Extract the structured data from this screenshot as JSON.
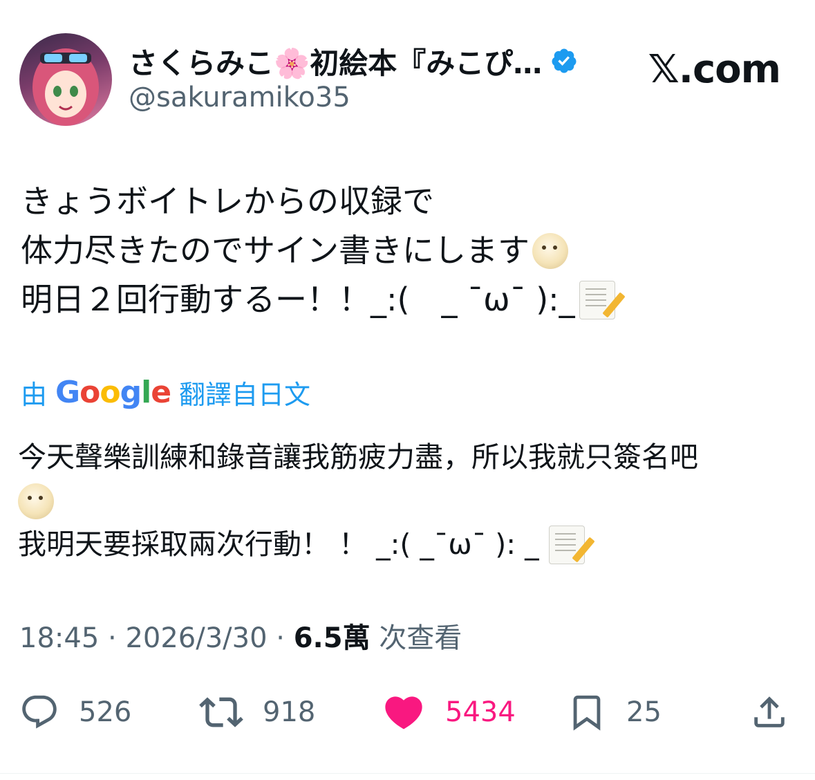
{
  "author": {
    "display_name": "さくらみこ🌸初絵本『みこぴ…",
    "handle": "@sakuramiko35",
    "verified": true
  },
  "site_logo": "𝕏.com",
  "tweet": {
    "lines": [
      "きょうボイトレからの収録で",
      "体力尽きたのでサイン書きにします",
      "明日２回行動するー！！_:(　_ ˉωˉ ):_"
    ],
    "emojis": [
      "face-in-clouds",
      "memo"
    ]
  },
  "translation": {
    "prefix": "由",
    "provider": "Google",
    "suffix": "翻譯自日文",
    "lines": [
      "今天聲樂訓練和錄音讓我筋疲力盡，所以我就只簽名吧",
      "",
      "我明天要採取兩次行動！ ！ _:( _ˉωˉ ): _"
    ]
  },
  "meta": {
    "time": "18:45",
    "date": "2026/3/30",
    "views": "6.5萬",
    "views_label": "次查看"
  },
  "actions": {
    "replies": "526",
    "reposts": "918",
    "likes": "5434",
    "bookmarks": "25",
    "liked": true
  },
  "colors": {
    "accent": "#1d9bf0",
    "like": "#f91880",
    "secondary_text": "#536471"
  }
}
